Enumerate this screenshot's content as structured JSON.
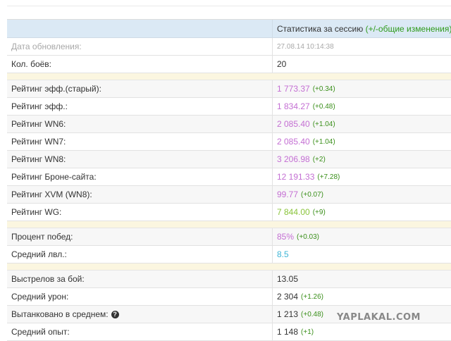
{
  "header": {
    "session_label": "Статистика за сессию",
    "session_hint": "(+/-общие изменения)"
  },
  "rows": {
    "update_date": {
      "label": "Дата обновления:",
      "value": "27.08.14 10:14:38"
    },
    "battles": {
      "label": "Кол. боёв:",
      "value": "20"
    },
    "eff_old": {
      "label": "Рейтинг эфф.(старый):",
      "value": "1 773.37",
      "delta": "(+0.34)"
    },
    "eff": {
      "label": "Рейтинг эфф.:",
      "value": "1 834.27",
      "delta": "(+0.48)"
    },
    "wn6": {
      "label": "Рейтинг WN6:",
      "value": "2 085.40",
      "delta": "(+1.04)"
    },
    "wn7": {
      "label": "Рейтинг WN7:",
      "value": "2 085.40",
      "delta": "(+1.04)"
    },
    "wn8": {
      "label": "Рейтинг WN8:",
      "value": "3 206.98",
      "delta": "(+2)"
    },
    "brone": {
      "label": "Рейтинг Броне-сайта:",
      "value": "12 191.33",
      "delta": "(+7.28)"
    },
    "xvm": {
      "label": "Рейтинг XVM (WN8):",
      "value": "99.77",
      "delta": "(+0.07)"
    },
    "wg": {
      "label": "Рейтинг WG:",
      "value": "7 844.00",
      "delta": "(+9)"
    },
    "winrate": {
      "label": "Процент побед:",
      "value": "85%",
      "delta": "(+0.03)"
    },
    "avg_level": {
      "label": "Средний лвл.:",
      "value": "8.5"
    },
    "shots": {
      "label": "Выстрелов за бой:",
      "value": "13.05"
    },
    "avg_damage": {
      "label": "Средний урон:",
      "value": "2 304",
      "delta": "(+1.26)"
    },
    "tanked": {
      "label": "Вытанковано в среднем:",
      "value": "1 213",
      "delta": "(+0.48)"
    },
    "avg_xp": {
      "label": "Средний опыт:",
      "value": "1 148",
      "delta": "(+1)"
    }
  },
  "icons": {
    "help": "question-circle-icon"
  },
  "watermark": "YAPLAKAL.COM",
  "colors": {
    "header_bg": "#dbe9f5",
    "separator_bg": "#fbf6e0",
    "rating_purple": "#c46fd3",
    "level_cyan": "#3eb5d6",
    "wg_green": "#8ac43b",
    "delta_green": "#3a8f1a"
  }
}
